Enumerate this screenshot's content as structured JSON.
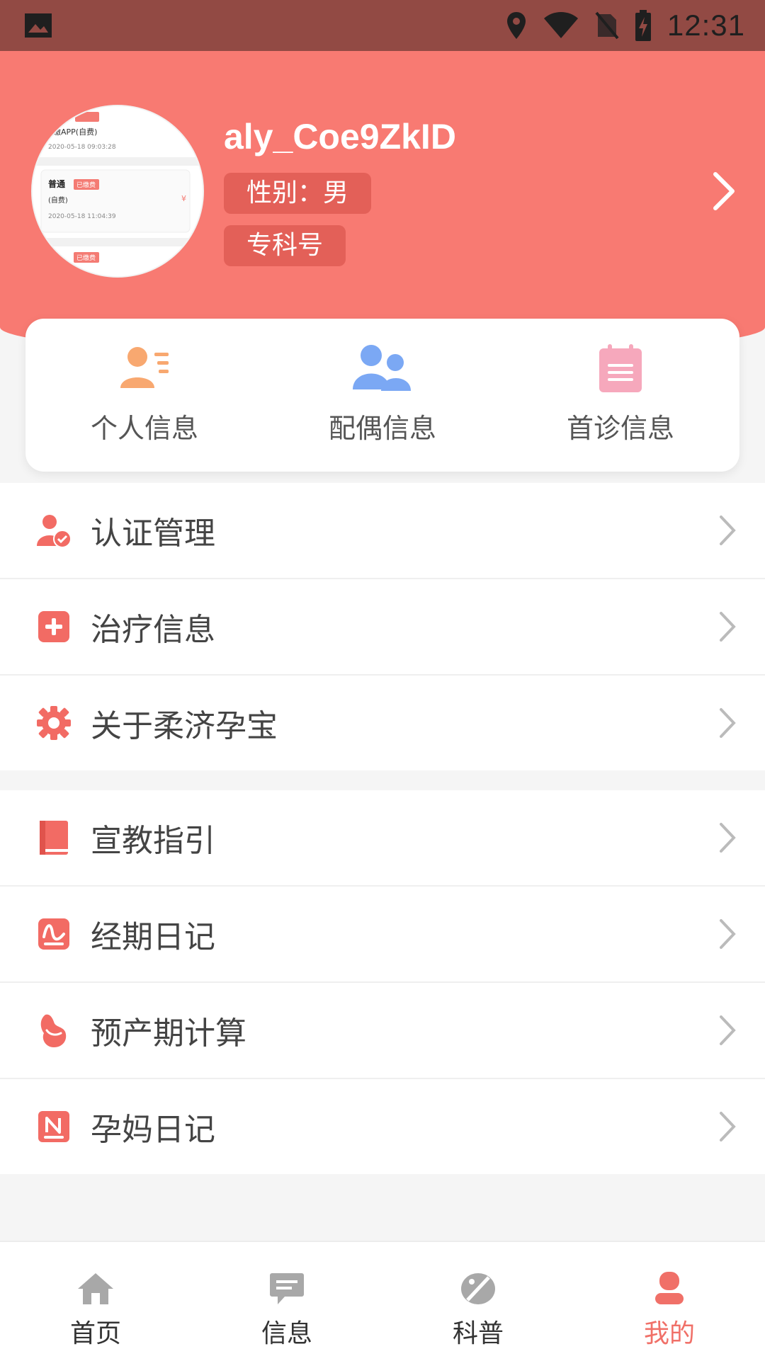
{
  "status_bar": {
    "time": "12:31",
    "icons": [
      "image-icon",
      "location-icon",
      "wifi-icon",
      "no-sim-icon",
      "battery-charging-icon"
    ]
  },
  "profile": {
    "username": "aly_Coe9ZkID",
    "gender_label": "性别：男",
    "department_label": "专科号",
    "avatar_thumb": {
      "line1": "..缴APP(自费)",
      "line1_date": "2020-05-18 09:03:28",
      "line2_title": "普通",
      "line2_badge": "已缴费",
      "line2_sub": "(自费)",
      "line2_date": "2020-05-18 11:04:39",
      "line3_badge": "已缴费"
    }
  },
  "quick_actions": [
    {
      "label": "个人信息",
      "icon": "personal-info-icon",
      "color": "#f8a870"
    },
    {
      "label": "配偶信息",
      "icon": "spouse-info-icon",
      "color": "#7ba8f4"
    },
    {
      "label": "首诊信息",
      "icon": "first-visit-icon",
      "color": "#f6a8bc"
    }
  ],
  "menu_group_1": [
    {
      "label": "认证管理",
      "icon": "verify-user-icon"
    },
    {
      "label": "治疗信息",
      "icon": "medical-plus-icon"
    },
    {
      "label": "关于柔济孕宝",
      "icon": "gear-icon"
    }
  ],
  "menu_group_2": [
    {
      "label": "宣教指引",
      "icon": "book-icon"
    },
    {
      "label": "经期日记",
      "icon": "period-diary-icon"
    },
    {
      "label": "预产期计算",
      "icon": "due-date-icon"
    },
    {
      "label": "孕妈日记",
      "icon": "mom-diary-icon"
    }
  ],
  "bottom_nav": [
    {
      "label": "首页",
      "icon": "home-icon",
      "active": false
    },
    {
      "label": "信息",
      "icon": "message-icon",
      "active": false
    },
    {
      "label": "科普",
      "icon": "science-icon",
      "active": false
    },
    {
      "label": "我的",
      "icon": "profile-icon",
      "active": true
    }
  ],
  "colors": {
    "header_bg": "#f87a72",
    "status_bar_bg": "#924a44",
    "accent": "#f07068",
    "tag_bg": "#e36058"
  }
}
